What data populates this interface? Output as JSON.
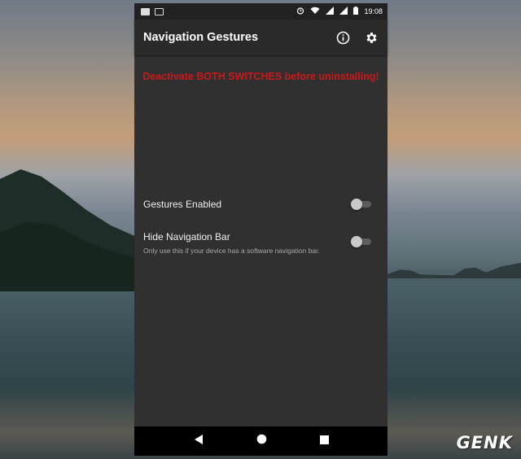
{
  "status_bar": {
    "time": "19:08",
    "icons": [
      "notification-box-icon",
      "image-icon",
      "alarm-icon",
      "wifi-icon",
      "signal-icon",
      "signal-icon",
      "battery-icon"
    ]
  },
  "app_bar": {
    "title": "Navigation Gestures",
    "actions": [
      "info-icon",
      "gear-icon"
    ]
  },
  "warning": {
    "text": "Deactivate BOTH SWITCHES before uninstalling!",
    "color": "#cc1818"
  },
  "settings": [
    {
      "title": "Gestures Enabled",
      "subtitle": "",
      "switch_on": false
    },
    {
      "title": "Hide Navigation Bar",
      "subtitle": "Only use this if your device has a software navigation bar.",
      "switch_on": false
    }
  ],
  "nav_bar": {
    "buttons": [
      "back-icon",
      "home-icon",
      "recents-icon"
    ]
  },
  "watermark": "GENK"
}
